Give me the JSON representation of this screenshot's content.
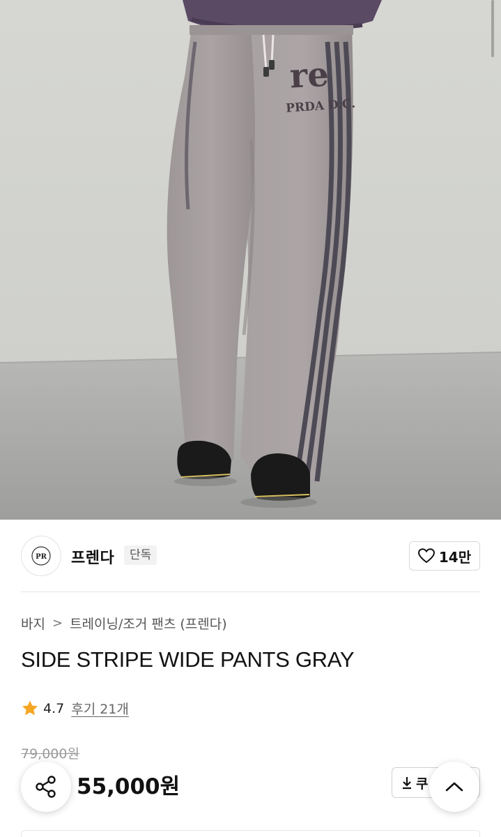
{
  "product_image": {
    "alt": "product-photo",
    "print_text_top": "re",
    "print_text_bottom": "PRDA D.C."
  },
  "brand": {
    "logo_text": "PR",
    "name": "프렌다",
    "tag": "단독",
    "like_count": "14만"
  },
  "breadcrumb": {
    "category": "바지",
    "separator": ">",
    "subcategory": "트레이닝/조거 팬츠 (프렌다)"
  },
  "product": {
    "title": "SIDE STRIPE WIDE PANTS GRAY",
    "rating": "4.7",
    "review_link": "후기 21개",
    "original_price": "79,000원",
    "price": "55,000원"
  },
  "actions": {
    "coupon_label": "쿠",
    "share_icon": "share-icon",
    "top_icon": "chevron-up-icon"
  },
  "colors": {
    "star": "#f5a623",
    "pants": "#a39c9d",
    "stripe": "#4e4a55"
  }
}
